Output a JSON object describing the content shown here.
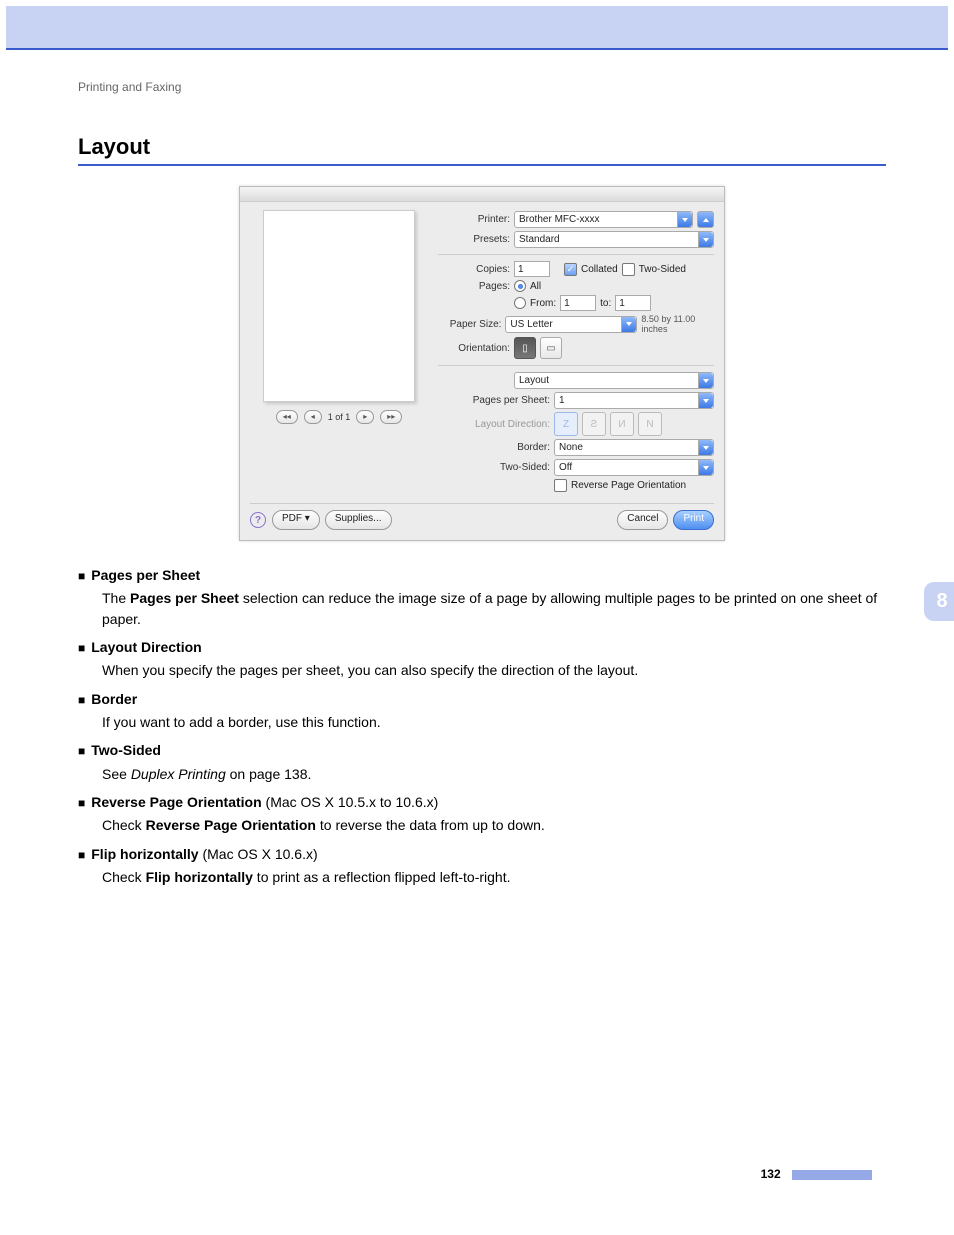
{
  "header": {
    "running_head": "Printing and Faxing",
    "section_title": "Layout"
  },
  "dialog": {
    "preview": {
      "page_indicator": "1 of 1"
    },
    "printer_label": "Printer:",
    "printer_value": "Brother MFC-xxxx",
    "presets_label": "Presets:",
    "presets_value": "Standard",
    "copies_label": "Copies:",
    "copies_value": "1",
    "collated_label": "Collated",
    "two_sided_label": "Two-Sided",
    "pages_label": "Pages:",
    "pages_all_label": "All",
    "pages_from_label": "From:",
    "pages_from_value": "1",
    "pages_to_label": "to:",
    "pages_to_value": "1",
    "paper_size_label": "Paper Size:",
    "paper_size_value": "US Letter",
    "paper_size_hint": "8.50 by 11.00 inches",
    "orientation_label": "Orientation:",
    "panel_select_value": "Layout",
    "pages_per_sheet_label": "Pages per Sheet:",
    "pages_per_sheet_value": "1",
    "layout_direction_label": "Layout Direction:",
    "border_label": "Border:",
    "border_value": "None",
    "two_sided_select_label": "Two-Sided:",
    "two_sided_select_value": "Off",
    "reverse_label": "Reverse Page Orientation",
    "pdf_button": "PDF ▾",
    "supplies_button": "Supplies...",
    "cancel_button": "Cancel",
    "print_button": "Print"
  },
  "items": {
    "pps": {
      "title": "Pages per Sheet",
      "desc_pre": "The ",
      "desc_bold": "Pages per Sheet",
      "desc_post": " selection can reduce the image size of a page by allowing multiple pages to be printed on one sheet of paper."
    },
    "layout_dir": {
      "title": "Layout Direction",
      "desc": "When you specify the pages per sheet, you can also specify the direction of the layout."
    },
    "border": {
      "title": "Border",
      "desc": "If you want to add a border, use this function."
    },
    "two_sided": {
      "title": "Two-Sided",
      "desc_pre": "See ",
      "desc_ital": "Duplex Printing",
      "desc_post": " on page 138."
    },
    "reverse": {
      "title": "Reverse Page Orientation",
      "title_suffix": " (Mac OS X 10.5.x to 10.6.x)",
      "desc_pre": "Check ",
      "desc_bold": "Reverse Page Orientation",
      "desc_post": " to reverse the data from up to down."
    },
    "flip": {
      "title": "Flip horizontally",
      "title_suffix": " (Mac OS X 10.6.x)",
      "desc_pre": "Check ",
      "desc_bold": "Flip horizontally",
      "desc_post": " to print as a reflection flipped left-to-right."
    }
  },
  "side_tab": "8",
  "page_number": "132"
}
